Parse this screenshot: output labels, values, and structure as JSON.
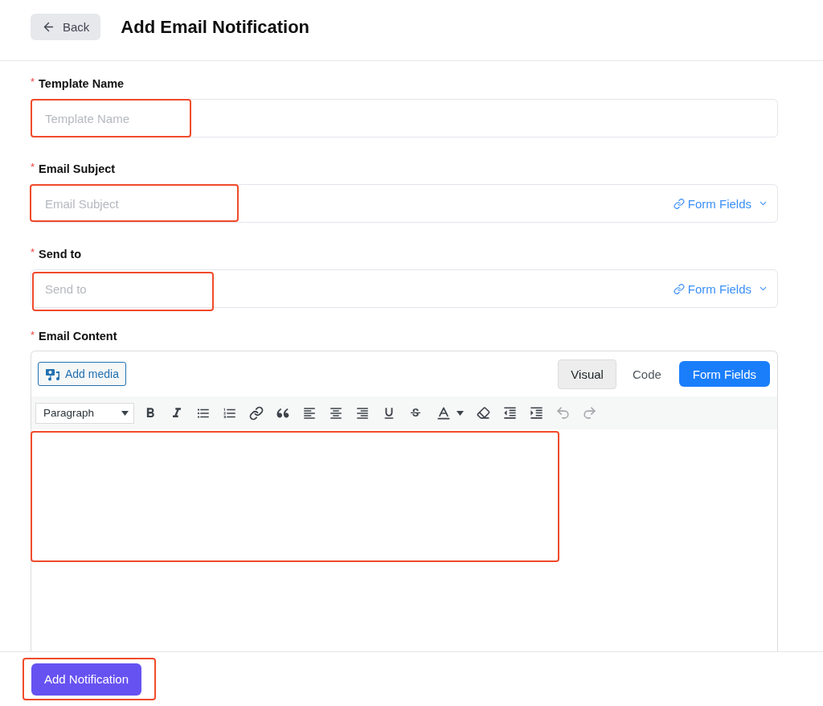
{
  "header": {
    "back_button": {
      "label": "Back"
    },
    "title": "Add Email Notification"
  },
  "fields": [
    {
      "required_mark": "*",
      "label": "Template Name",
      "placeholder": "Template Name",
      "highlighted": true
    },
    {
      "required_mark": "*",
      "label": "Email Subject",
      "placeholder": "Email Subject",
      "addon": "Form Fields",
      "highlighted": true
    },
    {
      "required_mark": "*",
      "label": "Send to",
      "placeholder": "Send to",
      "addon": "Form Fields",
      "highlighted": true
    }
  ],
  "editor": {
    "required_mark": "*",
    "label": "Email Content",
    "add_media": "Add media",
    "tabs": [
      {
        "label": "Visual",
        "selected": true
      },
      {
        "label": "Code",
        "selected": false
      }
    ],
    "form_fields_button": "Form Fields",
    "format_select": "Paragraph",
    "toolbar": [
      {
        "kind": "bold",
        "disabled": false
      },
      {
        "kind": "italic",
        "disabled": false
      },
      {
        "kind": "bullets",
        "disabled": false
      },
      {
        "kind": "numbers",
        "disabled": false
      },
      {
        "kind": "link",
        "disabled": false
      },
      {
        "kind": "quote",
        "disabled": false
      },
      {
        "kind": "align-left",
        "disabled": false
      },
      {
        "kind": "align-center",
        "disabled": false
      },
      {
        "kind": "align-right",
        "disabled": false
      },
      {
        "kind": "underline",
        "disabled": false
      },
      {
        "kind": "strikethrough",
        "disabled": false
      },
      {
        "kind": "text-color",
        "disabled": false
      },
      {
        "kind": "eraser",
        "disabled": false
      },
      {
        "kind": "outdent",
        "disabled": false
      },
      {
        "kind": "indent",
        "disabled": false
      },
      {
        "kind": "undo",
        "disabled": true
      },
      {
        "kind": "redo",
        "disabled": true
      }
    ],
    "highlighted": true
  },
  "footer": {
    "submit_button": {
      "label": "Add Notification",
      "highlighted": true
    }
  }
}
